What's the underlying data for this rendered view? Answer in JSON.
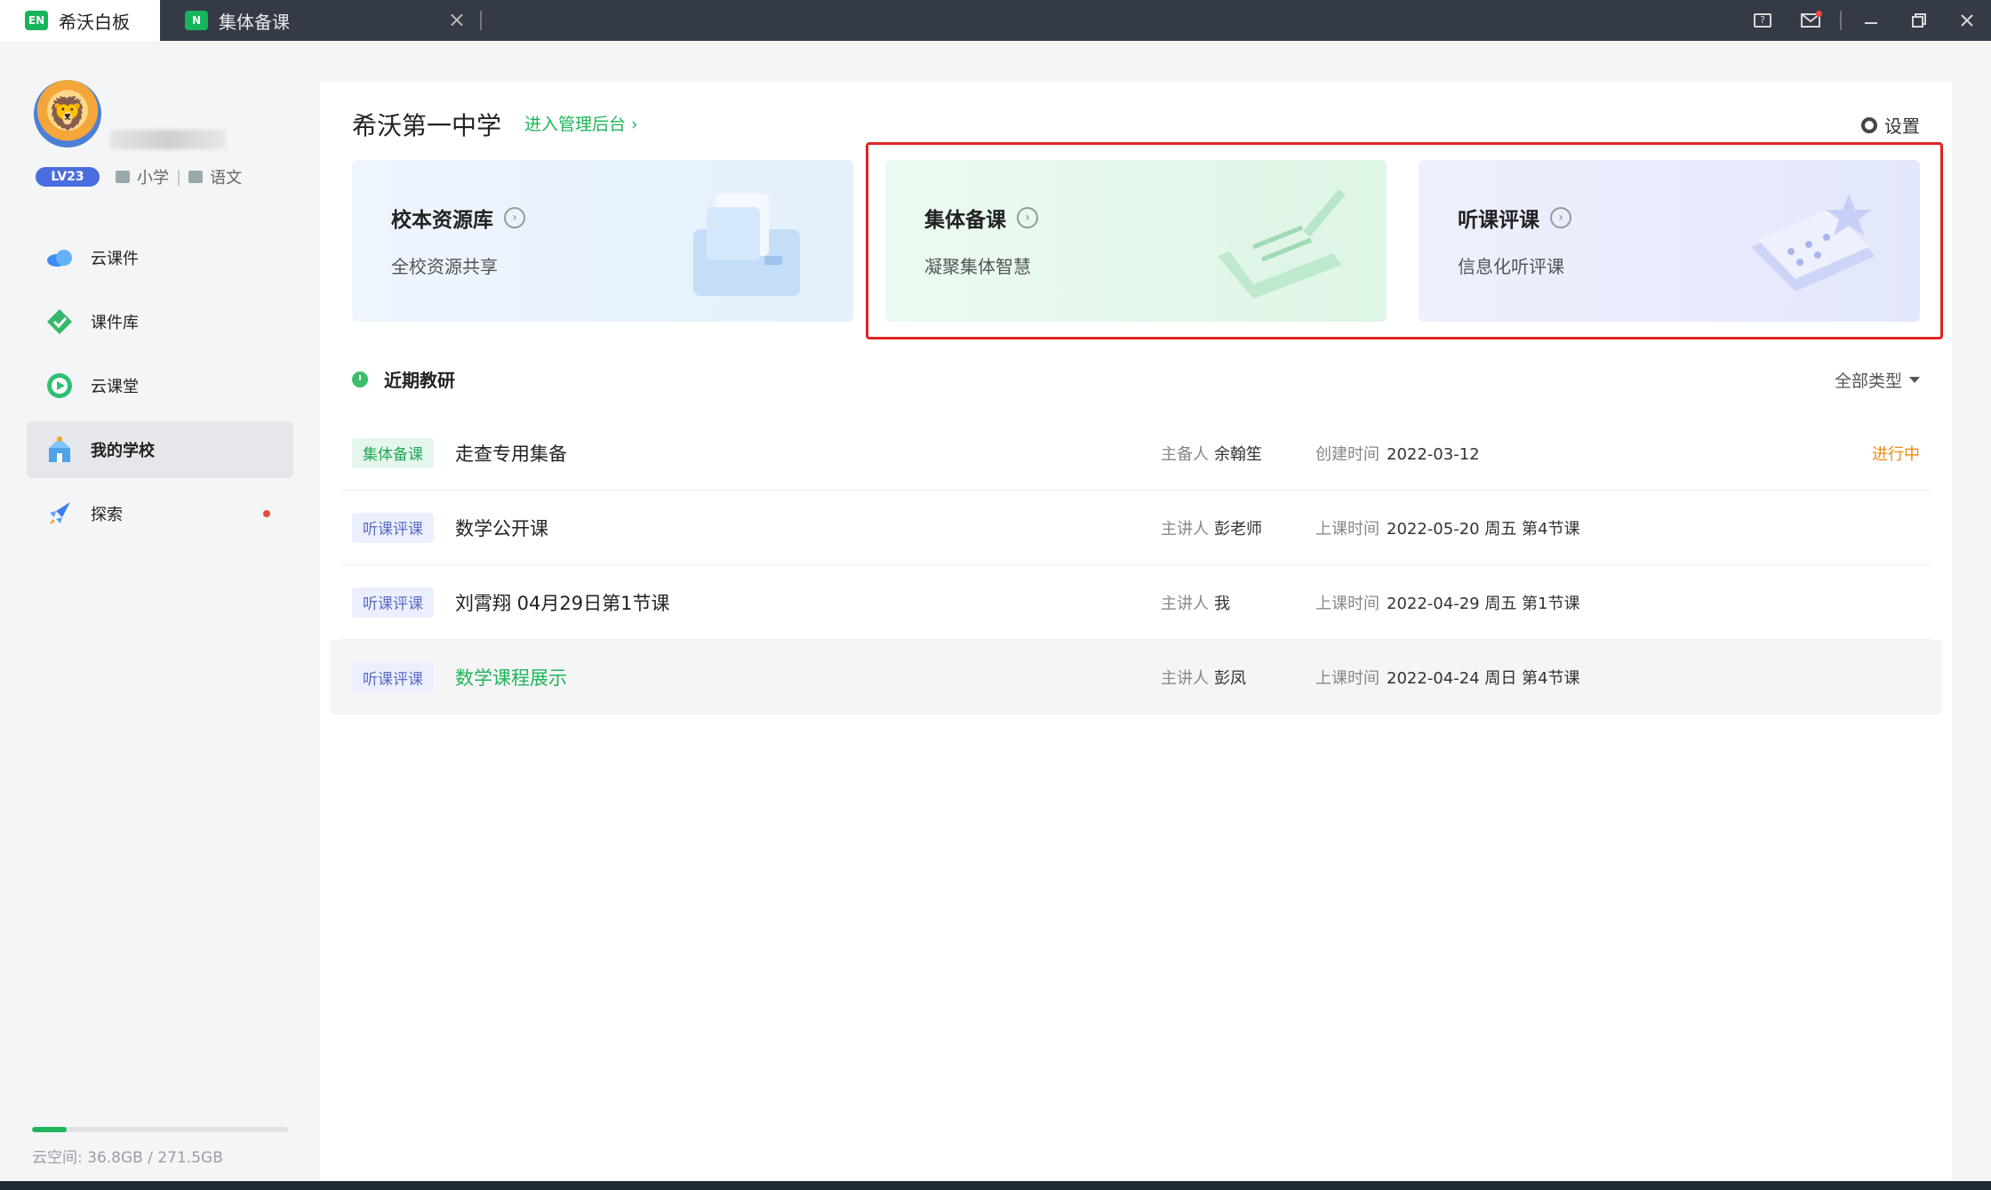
{
  "titlebar": {
    "app_tab": {
      "logo": "EN",
      "label": "希沃白板"
    },
    "doc_tab": {
      "logo": "N",
      "label": "集体备课"
    },
    "icons": [
      "help-icon",
      "mail-icon",
      "minimize-icon",
      "restore-icon",
      "close-icon"
    ]
  },
  "sidebar": {
    "profile": {
      "level": "LV23",
      "stage": "小学",
      "subject": "语文"
    },
    "items": [
      {
        "label": "云课件",
        "icon": "cloud-icon"
      },
      {
        "label": "课件库",
        "icon": "library-icon"
      },
      {
        "label": "云课堂",
        "icon": "play-icon"
      },
      {
        "label": "我的学校",
        "icon": "school-icon",
        "active": true
      },
      {
        "label": "探索",
        "icon": "rocket-icon",
        "badge": true
      }
    ],
    "storage": {
      "label": "云空间:",
      "used": "36.8GB / 271.5GB",
      "fraction": 0.136
    }
  },
  "main": {
    "school_name": "希沃第一中学",
    "admin_link": "进入管理后台 ›",
    "settings_label": "设置",
    "cards": [
      {
        "title": "校本资源库",
        "subtitle": "全校资源共享"
      },
      {
        "title": "集体备课",
        "subtitle": "凝聚集体智慧"
      },
      {
        "title": "听课评课",
        "subtitle": "信息化听评课"
      }
    ],
    "recent": {
      "heading": "近期教研",
      "filter": "全部类型",
      "rows": [
        {
          "tag": "集体备课",
          "tag_color": "green",
          "title": "走查专用集备",
          "host_label": "主备人",
          "host": "余翰笙",
          "time_label": "创建时间",
          "time": "2022-03-12",
          "status": "进行中"
        },
        {
          "tag": "听课评课",
          "tag_color": "blue",
          "title": "数学公开课",
          "host_label": "主讲人",
          "host": "彭老师",
          "time_label": "上课时间",
          "time": "2022-05-20 周五 第4节课",
          "status": ""
        },
        {
          "tag": "听课评课",
          "tag_color": "blue",
          "title": "刘霄翔 04月29日第1节课",
          "host_label": "主讲人",
          "host": "我",
          "time_label": "上课时间",
          "time": "2022-04-29 周五 第1节课",
          "status": ""
        },
        {
          "tag": "听课评课",
          "tag_color": "blue",
          "title": "数学课程展示",
          "host_label": "主讲人",
          "host": "彭凤",
          "time_label": "上课时间",
          "time": "2022-04-24 周日 第4节课",
          "status": ""
        }
      ]
    }
  },
  "colors": {
    "accent": "#1fb55a",
    "status_in_progress": "#f08a14",
    "highlight": "#e02424"
  }
}
